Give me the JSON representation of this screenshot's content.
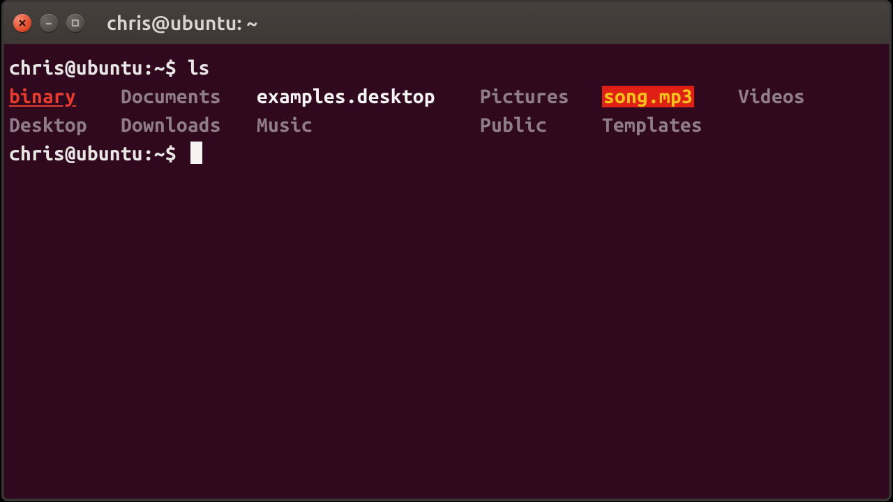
{
  "titlebar": {
    "title": "chris@ubuntu: ~"
  },
  "prompt": {
    "user_host": "chris@ubuntu",
    "colon": ":",
    "path": "~",
    "dollar": "$"
  },
  "cmd1": "ls",
  "ls": {
    "r1": {
      "c1": "binary",
      "c2": "Documents",
      "c3": "examples.desktop",
      "c4": "Pictures",
      "c5": "song.mp3",
      "c6": "Videos"
    },
    "r2": {
      "c1": "Desktop",
      "c2": "Downloads",
      "c3": "Music",
      "c4": "Public",
      "c5": "Templates",
      "c6": ""
    }
  }
}
